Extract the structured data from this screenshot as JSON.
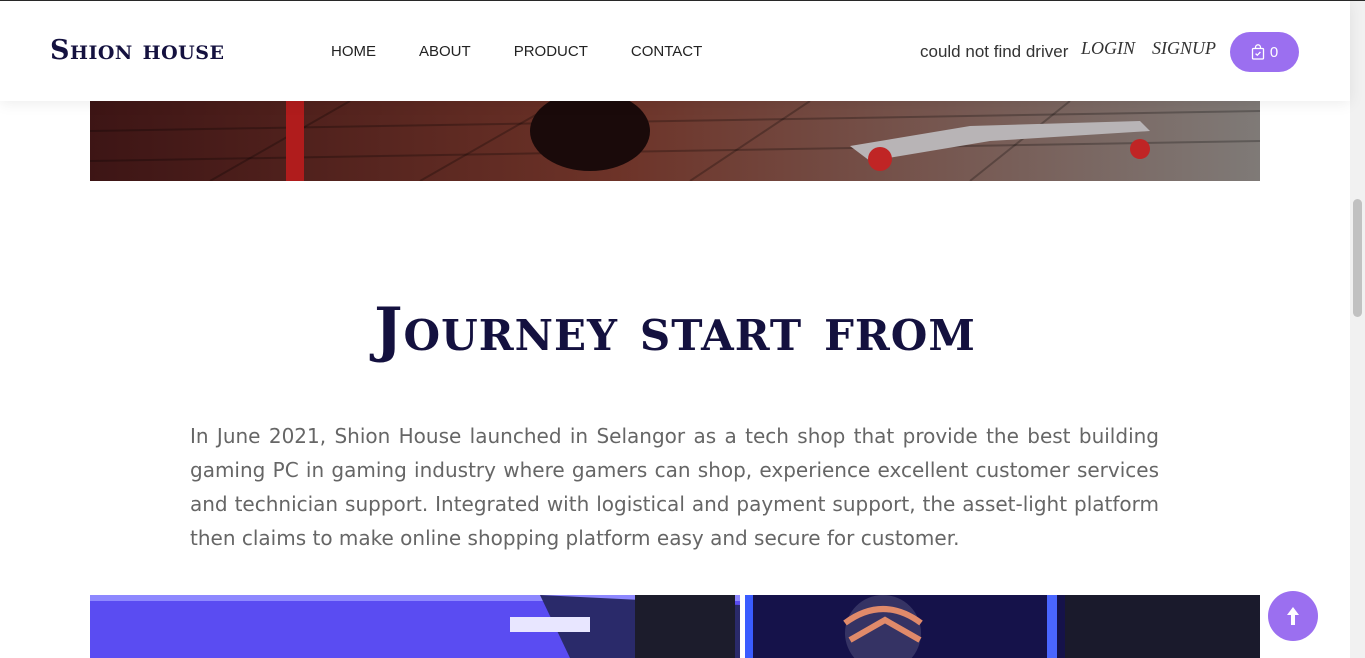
{
  "header": {
    "logo": "Shion house",
    "nav": [
      "HOME",
      "ABOUT",
      "PRODUCT",
      "CONTACT"
    ],
    "driver_message": "could not find driver",
    "login": "LOGIN",
    "signup": "SIGNUP",
    "cart_count": "0"
  },
  "main": {
    "title": "Journey start from",
    "paragraph": "In June 2021, Shion House launched in Selangor as a tech shop that provide the best building gaming PC in gaming industry where gamers can shop, experience excellent customer services and technician support. Integrated with logistical and payment support, the asset-light platform then claims to make online shopping platform easy and secure for customer."
  },
  "colors": {
    "brand": "#14113f",
    "accent": "#9b6ff0"
  },
  "icons": {
    "cart": "shopping-bag-icon",
    "scroll_top": "arrow-up-icon"
  }
}
